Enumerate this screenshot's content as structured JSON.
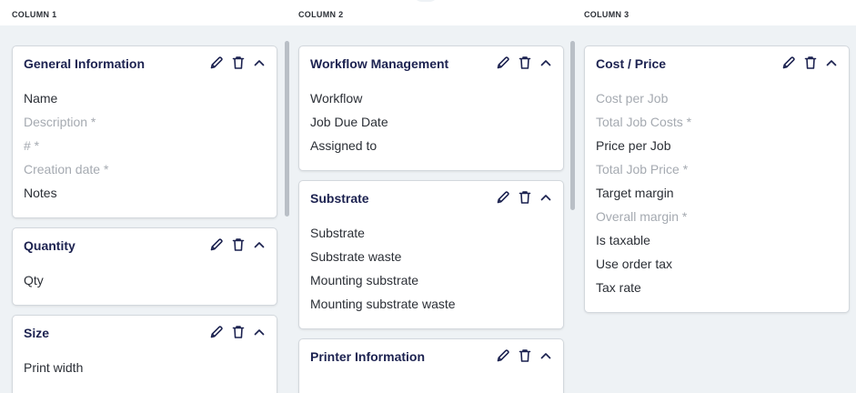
{
  "columns": [
    {
      "label": "COLUMN 1",
      "cards": [
        {
          "title": "General Information",
          "fields": [
            {
              "label": "Name",
              "muted": false
            },
            {
              "label": "Description *",
              "muted": true
            },
            {
              "label": "# *",
              "muted": true
            },
            {
              "label": "Creation date *",
              "muted": true
            },
            {
              "label": "Notes",
              "muted": false
            }
          ]
        },
        {
          "title": "Quantity",
          "fields": [
            {
              "label": "Qty",
              "muted": false
            }
          ]
        },
        {
          "title": "Size",
          "fields": [
            {
              "label": "Print width",
              "muted": false
            }
          ]
        }
      ]
    },
    {
      "label": "COLUMN 2",
      "cards": [
        {
          "title": "Workflow Management",
          "fields": [
            {
              "label": "Workflow",
              "muted": false
            },
            {
              "label": "Job Due Date",
              "muted": false
            },
            {
              "label": "Assigned to",
              "muted": false
            }
          ]
        },
        {
          "title": "Substrate",
          "fields": [
            {
              "label": "Substrate",
              "muted": false
            },
            {
              "label": "Substrate waste",
              "muted": false
            },
            {
              "label": "Mounting substrate",
              "muted": false
            },
            {
              "label": "Mounting substrate waste",
              "muted": false
            }
          ]
        },
        {
          "title": "Printer Information",
          "fields": []
        }
      ]
    },
    {
      "label": "COLUMN 3",
      "cards": [
        {
          "title": "Cost / Price",
          "fields": [
            {
              "label": "Cost per Job",
              "muted": true
            },
            {
              "label": "Total Job Costs *",
              "muted": true
            },
            {
              "label": "Price per Job",
              "muted": false
            },
            {
              "label": "Total Job Price *",
              "muted": true
            },
            {
              "label": "Target margin",
              "muted": false
            },
            {
              "label": "Overall margin *",
              "muted": true
            },
            {
              "label": "Is taxable",
              "muted": false
            },
            {
              "label": "Use order tax",
              "muted": false
            },
            {
              "label": "Tax rate",
              "muted": false
            }
          ]
        }
      ]
    }
  ],
  "card_actions": {
    "edit_icon": "pencil-icon",
    "delete_icon": "trash-icon",
    "collapse_icon": "chevron-up-icon"
  },
  "colors": {
    "title": "#1c2250",
    "field_text": "#2b2f36",
    "field_muted": "#a5aab1",
    "background": "#eef2f5"
  }
}
